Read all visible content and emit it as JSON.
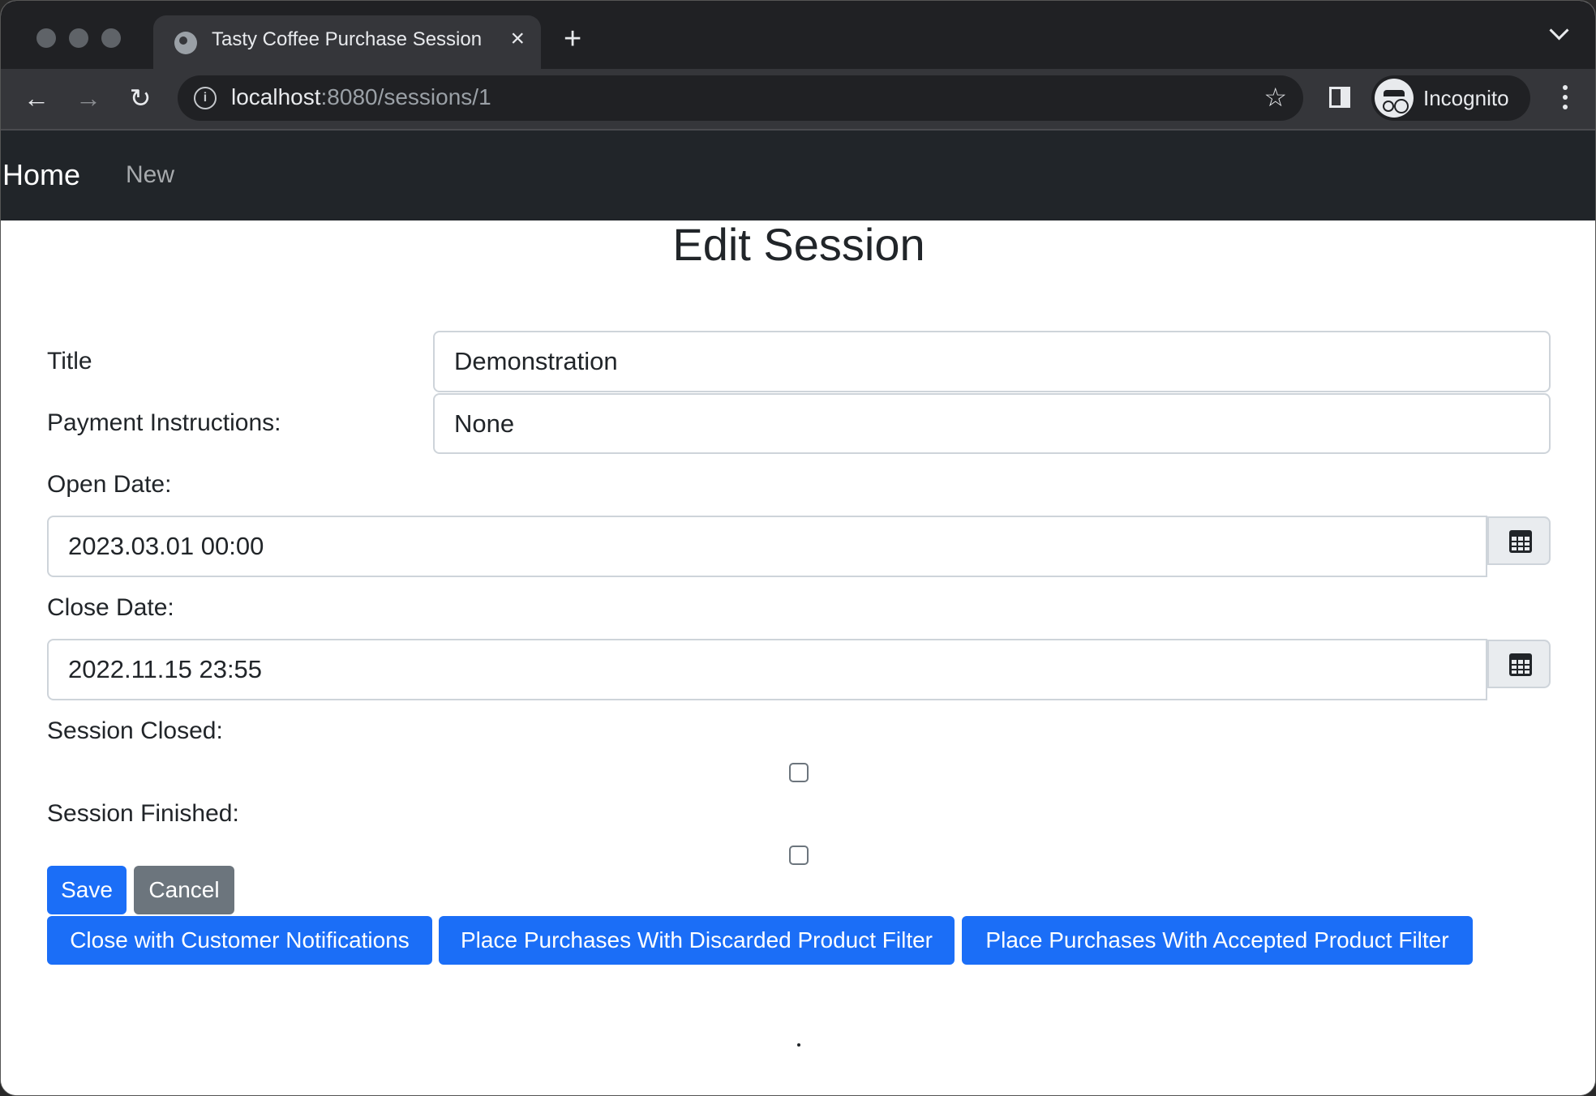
{
  "browser": {
    "tab_title": "Tasty Coffee Purchase Session",
    "url_host": "localhost",
    "url_path": ":8080/sessions/1",
    "profile_label": "Incognito"
  },
  "nav": {
    "brand": "Home",
    "new_link": "New"
  },
  "form": {
    "heading": "Edit Session",
    "title_label": "Title",
    "title_value": "Demonstration",
    "payment_label": "Payment Instructions:",
    "payment_value": "None",
    "open_label": "Open Date:",
    "open_value": "2023.03.01 00:00",
    "close_label": "Close Date:",
    "close_value": "2022.11.15 23:55",
    "closed_label": "Session Closed:",
    "closed_checked": false,
    "finished_label": "Session Finished:",
    "finished_checked": false
  },
  "buttons": {
    "save": "Save",
    "cancel": "Cancel",
    "close_notify": "Close with Customer Notifications",
    "discarded_filter": "Place Purchases With Discarded Product Filter",
    "accepted_filter": "Place Purchases With Accepted Product Filter"
  },
  "colors": {
    "primary": "#1b6ef7",
    "secondary": "#6c757d",
    "navbar": "#212529"
  }
}
